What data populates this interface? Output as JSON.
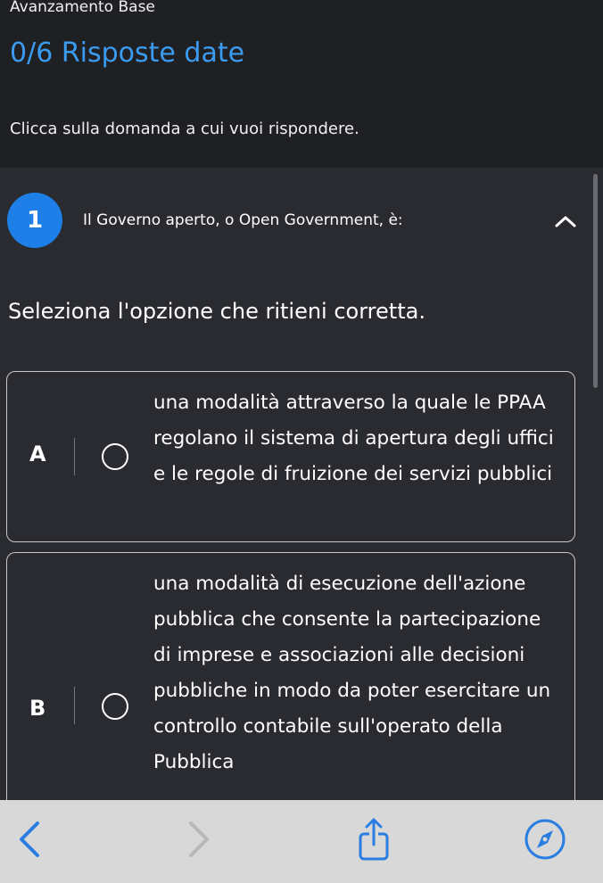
{
  "header": {
    "breadcrumb": "Avanzamento Base",
    "title": "0/6 Risposte date",
    "instruction": "Clicca sulla domanda a cui vuoi rispondere."
  },
  "question": {
    "number": "1",
    "text": "Il Governo aperto, o Open Government, è:",
    "select_hint": "Seleziona l'opzione che ritieni corretta."
  },
  "options": [
    {
      "letter": "A",
      "text": "una modalità attraverso la quale le PPAA regolano il sistema di apertura degli uffici e le regole di fruizione dei servizi pubblici"
    },
    {
      "letter": "B",
      "text": "una modalità di esecuzione dell'azione pubblica che consente la partecipazione di imprese e associazioni alle decisioni pubbliche in modo da poter esercitare un controllo contabile sull'operato della Pubblica"
    }
  ],
  "toolbar": {
    "icons": [
      "back-icon",
      "forward-icon",
      "share-icon",
      "compass-icon"
    ],
    "accent": "#2a7de1"
  },
  "colors": {
    "header_bg": "#1f2024",
    "main_bg": "#2a2b30",
    "title_blue": "#3b9bf0",
    "badge_blue": "#1f7fe8"
  }
}
